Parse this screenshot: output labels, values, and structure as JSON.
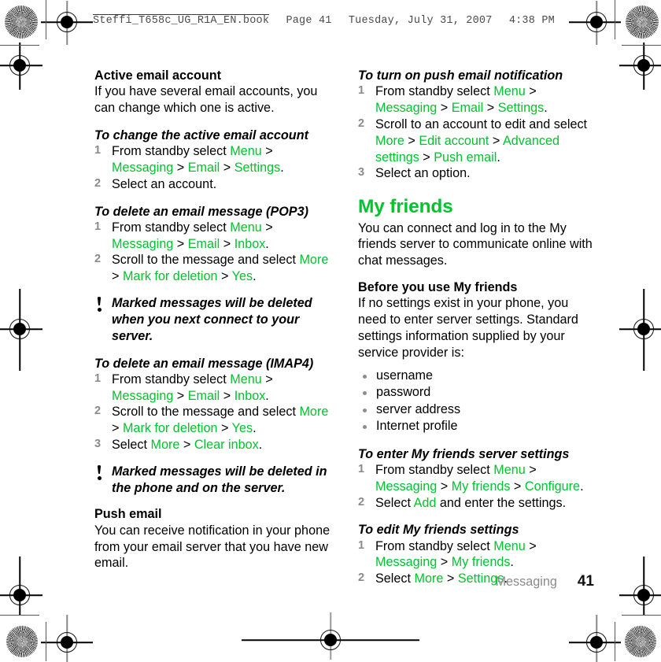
{
  "running_header": {
    "filename": "Steffi_T658c_UG_R1A_EN.book",
    "page": "Page 41",
    "date": "Tuesday, July 31, 2007",
    "time": "4:38 PM"
  },
  "colors": {
    "accent_green": "#00c32e",
    "step_number_gray": "#8a8a8a",
    "bullet_gray": "#8d8d8d"
  },
  "left_column": {
    "heading_active_account": "Active email account",
    "para_active_account": "If you have several email accounts, you can change which one is active.",
    "proc_change_active": {
      "title": "To change the active email account",
      "steps": [
        {
          "num": "1",
          "parts": [
            {
              "t": "From standby select ",
              "c": "black"
            },
            {
              "t": "Menu",
              "c": "green"
            },
            {
              "t": " > ",
              "c": "black"
            },
            {
              "t": "Messaging",
              "c": "green"
            },
            {
              "t": " > ",
              "c": "black"
            },
            {
              "t": "Email",
              "c": "green"
            },
            {
              "t": " > ",
              "c": "black"
            },
            {
              "t": "Settings",
              "c": "green"
            },
            {
              "t": ".",
              "c": "black"
            }
          ]
        },
        {
          "num": "2",
          "parts": [
            {
              "t": "Select an account.",
              "c": "black"
            }
          ]
        }
      ]
    },
    "proc_delete_pop3": {
      "title": "To delete an email message (POP3)",
      "steps": [
        {
          "num": "1",
          "parts": [
            {
              "t": "From standby select ",
              "c": "black"
            },
            {
              "t": "Menu",
              "c": "green"
            },
            {
              "t": " > ",
              "c": "black"
            },
            {
              "t": "Messaging",
              "c": "green"
            },
            {
              "t": " > ",
              "c": "black"
            },
            {
              "t": "Email",
              "c": "green"
            },
            {
              "t": " > ",
              "c": "black"
            },
            {
              "t": "Inbox",
              "c": "green"
            },
            {
              "t": ".",
              "c": "black"
            }
          ]
        },
        {
          "num": "2",
          "parts": [
            {
              "t": "Scroll to the message and select ",
              "c": "black"
            },
            {
              "t": "More",
              "c": "green"
            },
            {
              "t": " > ",
              "c": "black"
            },
            {
              "t": "Mark for deletion",
              "c": "green"
            },
            {
              "t": " > ",
              "c": "black"
            },
            {
              "t": "Yes",
              "c": "green"
            },
            {
              "t": ".",
              "c": "black"
            }
          ]
        }
      ]
    },
    "note_pop3": "Marked messages will be deleted when you next connect to your server.",
    "proc_delete_imap4": {
      "title": "To delete an email message (IMAP4)",
      "steps": [
        {
          "num": "1",
          "parts": [
            {
              "t": "From standby select ",
              "c": "black"
            },
            {
              "t": "Menu",
              "c": "green"
            },
            {
              "t": " > ",
              "c": "black"
            },
            {
              "t": "Messaging",
              "c": "green"
            },
            {
              "t": " > ",
              "c": "black"
            },
            {
              "t": "Email",
              "c": "green"
            },
            {
              "t": " > ",
              "c": "black"
            },
            {
              "t": "Inbox",
              "c": "green"
            },
            {
              "t": ".",
              "c": "black"
            }
          ]
        },
        {
          "num": "2",
          "parts": [
            {
              "t": "Scroll to the message and select ",
              "c": "black"
            },
            {
              "t": "More",
              "c": "green"
            },
            {
              "t": " > ",
              "c": "black"
            },
            {
              "t": "Mark for deletion",
              "c": "green"
            },
            {
              "t": " > ",
              "c": "black"
            },
            {
              "t": "Yes",
              "c": "green"
            },
            {
              "t": ".",
              "c": "black"
            }
          ]
        },
        {
          "num": "3",
          "parts": [
            {
              "t": "Select ",
              "c": "black"
            },
            {
              "t": "More",
              "c": "green"
            },
            {
              "t": " > ",
              "c": "black"
            },
            {
              "t": "Clear inbox",
              "c": "green"
            },
            {
              "t": ".",
              "c": "black"
            }
          ]
        }
      ]
    },
    "note_imap4": "Marked messages will be deleted in the phone and on the server.",
    "heading_push_email": "Push email",
    "para_push_email": "You can receive notification in your phone from your email server that you have new email."
  },
  "right_column": {
    "proc_push_notification": {
      "title": "To turn on push email notification",
      "steps": [
        {
          "num": "1",
          "parts": [
            {
              "t": "From standby select ",
              "c": "black"
            },
            {
              "t": "Menu",
              "c": "green"
            },
            {
              "t": " > ",
              "c": "black"
            },
            {
              "t": "Messaging",
              "c": "green"
            },
            {
              "t": " > ",
              "c": "black"
            },
            {
              "t": "Email",
              "c": "green"
            },
            {
              "t": " > ",
              "c": "black"
            },
            {
              "t": "Settings",
              "c": "green"
            },
            {
              "t": ".",
              "c": "black"
            }
          ]
        },
        {
          "num": "2",
          "parts": [
            {
              "t": "Scroll to an account to edit and select ",
              "c": "black"
            },
            {
              "t": "More",
              "c": "green"
            },
            {
              "t": " > ",
              "c": "black"
            },
            {
              "t": "Edit account",
              "c": "green"
            },
            {
              "t": " > ",
              "c": "black"
            },
            {
              "t": "Advanced settings",
              "c": "green"
            },
            {
              "t": " > ",
              "c": "black"
            },
            {
              "t": "Push email",
              "c": "green"
            },
            {
              "t": ".",
              "c": "black"
            }
          ]
        },
        {
          "num": "3",
          "parts": [
            {
              "t": "Select an option.",
              "c": "black"
            }
          ]
        }
      ]
    },
    "heading_my_friends": "My friends",
    "para_my_friends": "You can connect and log in to the My friends server to communicate online with chat messages.",
    "heading_before_use": "Before you use My friends",
    "para_before_use": "If no settings exist in your phone, you need to enter server settings. Standard settings information supplied by your service provider is:",
    "bullets": [
      "username",
      "password",
      "server address",
      "Internet profile"
    ],
    "proc_enter_server": {
      "title": "To enter My friends server settings",
      "steps": [
        {
          "num": "1",
          "parts": [
            {
              "t": "From standby select ",
              "c": "black"
            },
            {
              "t": "Menu",
              "c": "green"
            },
            {
              "t": " > ",
              "c": "black"
            },
            {
              "t": "Messaging",
              "c": "green"
            },
            {
              "t": " > ",
              "c": "black"
            },
            {
              "t": "My friends",
              "c": "green"
            },
            {
              "t": " > ",
              "c": "black"
            },
            {
              "t": "Configure",
              "c": "green"
            },
            {
              "t": ".",
              "c": "black"
            }
          ]
        },
        {
          "num": "2",
          "parts": [
            {
              "t": "Select ",
              "c": "black"
            },
            {
              "t": "Add",
              "c": "green"
            },
            {
              "t": " and enter the settings.",
              "c": "black"
            }
          ]
        }
      ]
    },
    "proc_edit_settings": {
      "title": "To edit My friends settings",
      "steps": [
        {
          "num": "1",
          "parts": [
            {
              "t": "From standby select ",
              "c": "black"
            },
            {
              "t": "Menu",
              "c": "green"
            },
            {
              "t": " > ",
              "c": "black"
            },
            {
              "t": "Messaging",
              "c": "green"
            },
            {
              "t": " > ",
              "c": "black"
            },
            {
              "t": "My friends",
              "c": "green"
            },
            {
              "t": ".",
              "c": "black"
            }
          ]
        },
        {
          "num": "2",
          "parts": [
            {
              "t": "Select ",
              "c": "black"
            },
            {
              "t": "More",
              "c": "green"
            },
            {
              "t": " > ",
              "c": "black"
            },
            {
              "t": "Settings",
              "c": "green"
            },
            {
              "t": ".",
              "c": "black"
            }
          ]
        }
      ]
    }
  },
  "footer": {
    "chapter": "Messaging",
    "page_number": "41"
  }
}
